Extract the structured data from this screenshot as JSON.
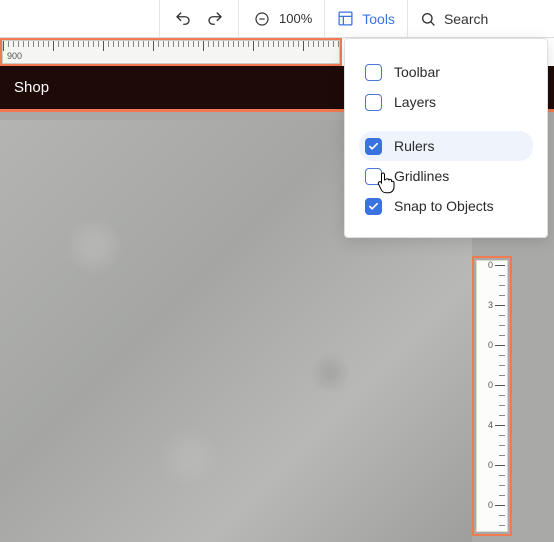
{
  "toolbar": {
    "zoom": "100%",
    "tools_label": "Tools",
    "search_label": "Search"
  },
  "ruler_h": {
    "label": "900"
  },
  "ruler_v": {
    "labels": [
      "0",
      "3",
      "0",
      "0",
      "4",
      "0",
      "0"
    ]
  },
  "shop_bar": {
    "label": "Shop"
  },
  "tools_menu": {
    "items": [
      {
        "label": "Toolbar",
        "checked": false
      },
      {
        "label": "Layers",
        "checked": false
      },
      {
        "label": "Rulers",
        "checked": true,
        "highlighted": true
      },
      {
        "label": "Gridlines",
        "checked": false
      },
      {
        "label": "Snap to Objects",
        "checked": true
      }
    ]
  }
}
